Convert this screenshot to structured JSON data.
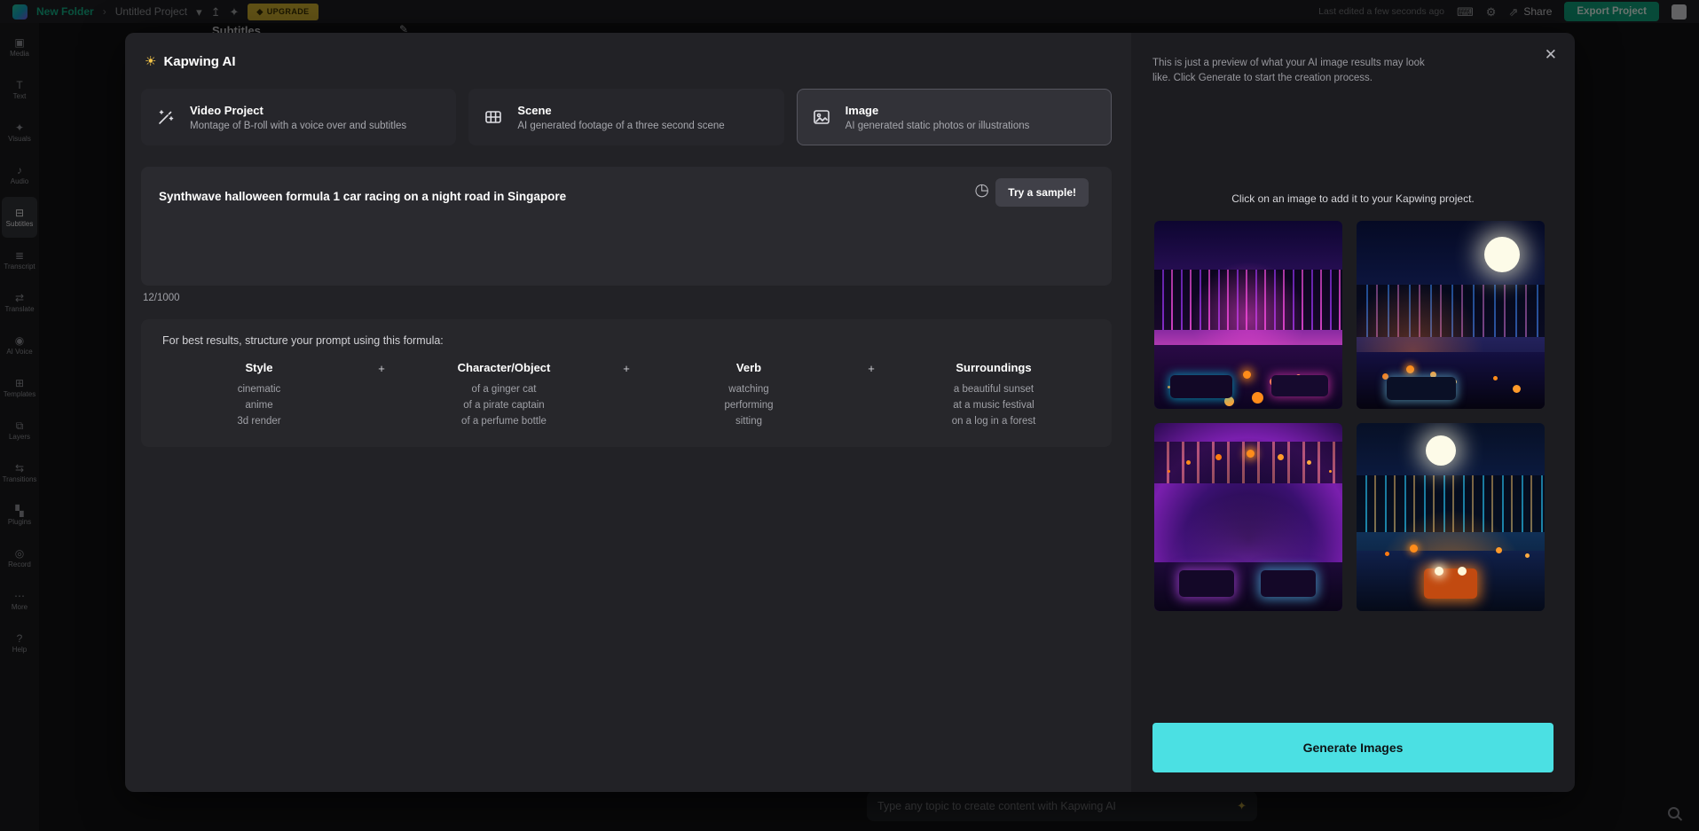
{
  "topbar": {
    "breadcrumb": {
      "folder": "New Folder",
      "separator": "›",
      "project": "Untitled Project"
    },
    "upgrade_label": "UPGRADE",
    "last_edited": "Last edited a few seconds ago",
    "share_label": "Share",
    "export_label": "Export Project"
  },
  "icons": {
    "chevron_down": "▾",
    "upload": "↥",
    "suggestion": "✦",
    "upgrade_gem": "◆",
    "keyboard": "⌨",
    "settings": "⚙",
    "share": "⇗",
    "close": "✕",
    "clock": "◷",
    "sun": "☀",
    "sparkle": "✦",
    "pencil": "✎"
  },
  "sidebar": {
    "items": [
      {
        "label": "Media",
        "icon": "▣"
      },
      {
        "label": "Text",
        "icon": "T"
      },
      {
        "label": "Visuals",
        "icon": "✦"
      },
      {
        "label": "Audio",
        "icon": "♪"
      },
      {
        "label": "Subtitles",
        "icon": "⊟"
      },
      {
        "label": "Transcript",
        "icon": "≣"
      },
      {
        "label": "Translate",
        "icon": "⇄"
      },
      {
        "label": "AI Voice",
        "icon": "◉"
      },
      {
        "label": "Templates",
        "icon": "⊞"
      },
      {
        "label": "Layers",
        "icon": "⧉"
      },
      {
        "label": "Transitions",
        "icon": "⇆"
      },
      {
        "label": "Plugins",
        "icon": "▚"
      },
      {
        "label": "Record",
        "icon": "◎"
      },
      {
        "label": "More",
        "icon": "⋯"
      },
      {
        "label": "Help",
        "icon": "?"
      }
    ]
  },
  "underlying": {
    "panel_title": "Subtitles"
  },
  "modal": {
    "title": "Kapwing AI",
    "tabs": [
      {
        "label": "Video Project",
        "description": "Montage of B-roll with a voice over and subtitles"
      },
      {
        "label": "Scene",
        "description": "AI generated footage of a three second scene"
      },
      {
        "label": "Image",
        "description": "AI generated static photos or illustrations"
      }
    ],
    "prompt": {
      "value": "Synthwave halloween formula 1 car racing on a night road in Singapore",
      "char_count": "12/1000",
      "sample_button": "Try a sample!"
    },
    "formula": {
      "intro": "For best results, structure your prompt using this formula:",
      "plus": "+",
      "columns": [
        {
          "header": "Style",
          "examples": [
            "cinematic",
            "anime",
            "3d render"
          ]
        },
        {
          "header": "Character/Object",
          "examples": [
            "of a ginger cat",
            "of a pirate captain",
            "of a perfume bottle"
          ]
        },
        {
          "header": "Verb",
          "examples": [
            "watching",
            "performing",
            "sitting"
          ]
        },
        {
          "header": "Surroundings",
          "examples": [
            "a beautiful sunset",
            "at a music festival",
            "on a log in a forest"
          ]
        }
      ]
    }
  },
  "preview": {
    "note": "This is just a preview of what your AI image results may look like. Click Generate to start the creation process.",
    "instruction": "Click on an image to add it to your Kapwing project.",
    "generate_button": "Generate Images",
    "accent_color": "#4BE0E3",
    "images": [
      {
        "name": "halloween-f1-neon-purple-city"
      },
      {
        "name": "halloween-f1-moonlit-city"
      },
      {
        "name": "halloween-f1-grid-tunnel"
      },
      {
        "name": "halloween-f1-moon-road"
      }
    ]
  },
  "bottom_bar": {
    "placeholder": "Type any topic to create content with Kapwing AI"
  }
}
